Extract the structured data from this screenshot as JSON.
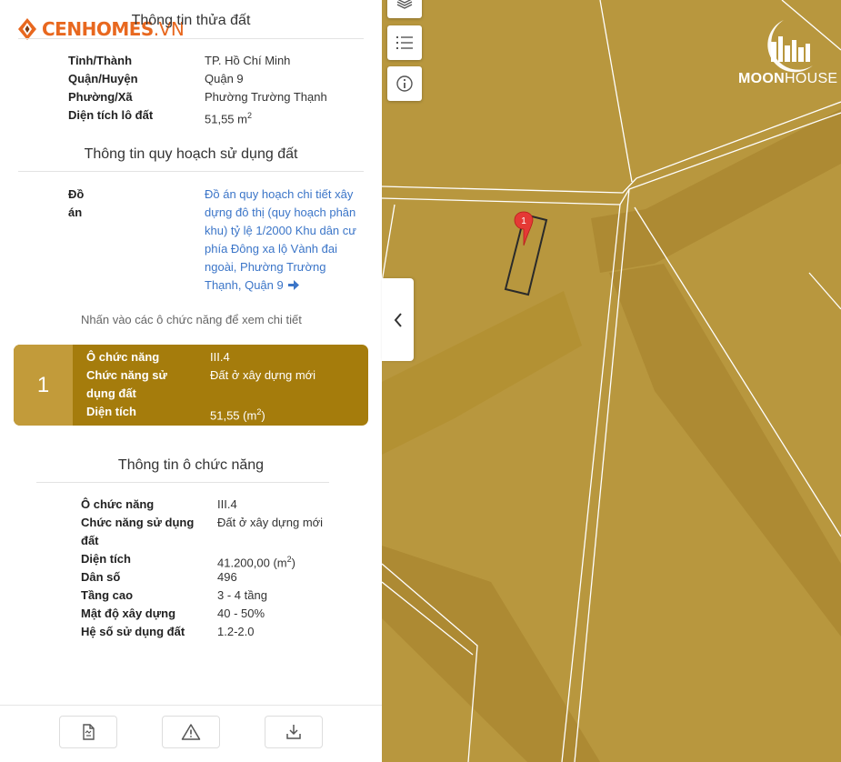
{
  "brand": {
    "logo_main": "CENHOMES",
    "logo_suffix": ".VN"
  },
  "land_info": {
    "title": "Thông tin thửa đất",
    "rows": [
      {
        "label": "Tỉnh/Thành",
        "value": "TP. Hồ Chí Minh"
      },
      {
        "label": "Quận/Huyện",
        "value": "Quận 9"
      },
      {
        "label": "Phường/Xã",
        "value": "Phường Trường Thạnh"
      },
      {
        "label": "Diện tích lô đất",
        "value": "51,55 m",
        "unit_sup": "2"
      }
    ]
  },
  "planning_info": {
    "title": "Thông tin quy hoạch sử dụng đất",
    "label": "Đồ án",
    "plan_name": "Đồ án quy hoạch chi tiết xây dựng đô thị (quy hoạch phân khu) tỷ lệ 1/2000 Khu dân cư phía Đông xa lộ Vành đai ngoài, Phường Trường Thạnh, Quận 9",
    "arrow_icon": "arrow-right-icon",
    "hint": "Nhấn vào các ô chức năng để xem chi tiết"
  },
  "function_card": {
    "number": "1",
    "rows": [
      {
        "label": "Ô chức năng",
        "value": "III.4"
      },
      {
        "label_line1": "Chức năng sử",
        "label_line2": "dụng đất",
        "value": "Đất ở xây dựng mới"
      },
      {
        "label": "Diện tích",
        "value": "51,55 (m",
        "unit_sup": "2",
        "value_tail": ")"
      }
    ],
    "colors": {
      "card_bg": "#a57c0c",
      "number_bg": "#c29b3a"
    }
  },
  "function_info": {
    "title": "Thông tin ô chức năng",
    "rows": [
      {
        "label": "Ô chức năng",
        "value": "III.4"
      },
      {
        "label_line1": "Chức năng sử dụng",
        "label_line2": "đất",
        "value": "Đất ở xây dựng mới"
      },
      {
        "label": "Diện tích",
        "value": "41.200,00 (m",
        "unit_sup": "2",
        "value_tail": ")"
      },
      {
        "label": "Dân số",
        "value": "496"
      },
      {
        "label": "Tầng cao",
        "value": "3 - 4 tầng"
      },
      {
        "label": "Mật độ xây dựng",
        "value": "40 - 50%"
      },
      {
        "label": "Hệ số sử dụng đất",
        "value": "1.2-2.0"
      }
    ]
  },
  "footer": {
    "buttons": [
      {
        "icon": "document-icon"
      },
      {
        "icon": "warning-icon"
      },
      {
        "icon": "download-icon"
      }
    ]
  },
  "map": {
    "controls": [
      {
        "icon": "layers-icon"
      },
      {
        "icon": "list-icon"
      },
      {
        "icon": "info-icon"
      }
    ],
    "collapse_icon": "chevron-left-icon",
    "marker_label": "1",
    "watermark_bold": "MOON",
    "watermark_light": "HOUSE",
    "colors": {
      "land": "#b8973e",
      "road_band": "#ad8a33",
      "line": "#ffffff",
      "marker": "#e53935"
    }
  }
}
